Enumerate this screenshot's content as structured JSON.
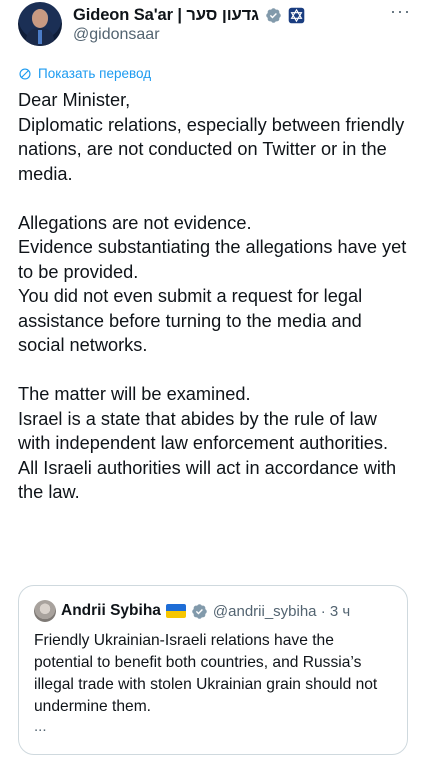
{
  "author": {
    "name": "Gideon Sa'ar | גדעון סער",
    "handle": "@gidonsaar",
    "more_label": "···",
    "accent_color": "#1d9bf0"
  },
  "translate_label": "Показать перевод",
  "tweet": {
    "paragraphs": [
      "Dear Minister,",
      "Diplomatic relations, especially between friendly nations, are not conducted on Twitter or in the media.",
      "",
      "Allegations are not evidence.",
      "Evidence substantiating the allegations have yet to be provided.",
      "You did not even submit a request for legal assistance before turning to the media and social networks.",
      "",
      "The matter will be examined.",
      "Israel is a state that abides by the rule of law with independent law enforcement authorities.",
      "All Israeli authorities will act in accordance with the law."
    ]
  },
  "quote": {
    "name": "Andrii Sybiha",
    "handle_time": "@andrii_sybiha · 3 ч",
    "text": "Friendly Ukrainian-Israeli relations have the potential to benefit both countries, and Russia’s illegal trade with stolen Ukrainian grain should not undermine them.",
    "ellipsis": "..."
  }
}
